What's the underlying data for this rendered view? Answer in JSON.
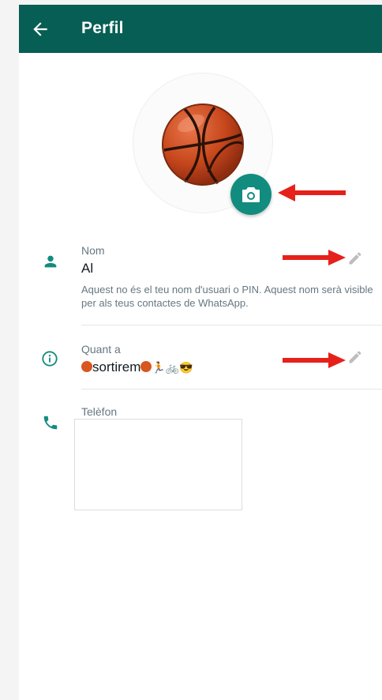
{
  "header": {
    "title": "Perfil",
    "back_icon": "arrow-left-icon"
  },
  "colors": {
    "appbar": "#075e54",
    "accent": "#128c7e",
    "annotation_arrow": "#e6211b"
  },
  "profile": {
    "photo_icon": "basketball",
    "camera_icon": "camera-icon"
  },
  "name": {
    "label": "Nom",
    "value": "Al",
    "hint": "Aquest no és el teu nom d'usuari o PIN. Aquest nom serà visible per als teus contactes de WhatsApp.",
    "icon": "person-icon",
    "edit_icon": "pencil-icon"
  },
  "about": {
    "label": "Quant a",
    "value_text": "sortirem",
    "value_emoji_trail": "🏃🚲😎",
    "icon": "info-icon",
    "edit_icon": "pencil-icon"
  },
  "phone": {
    "label": "Telèfon",
    "icon": "phone-icon"
  }
}
